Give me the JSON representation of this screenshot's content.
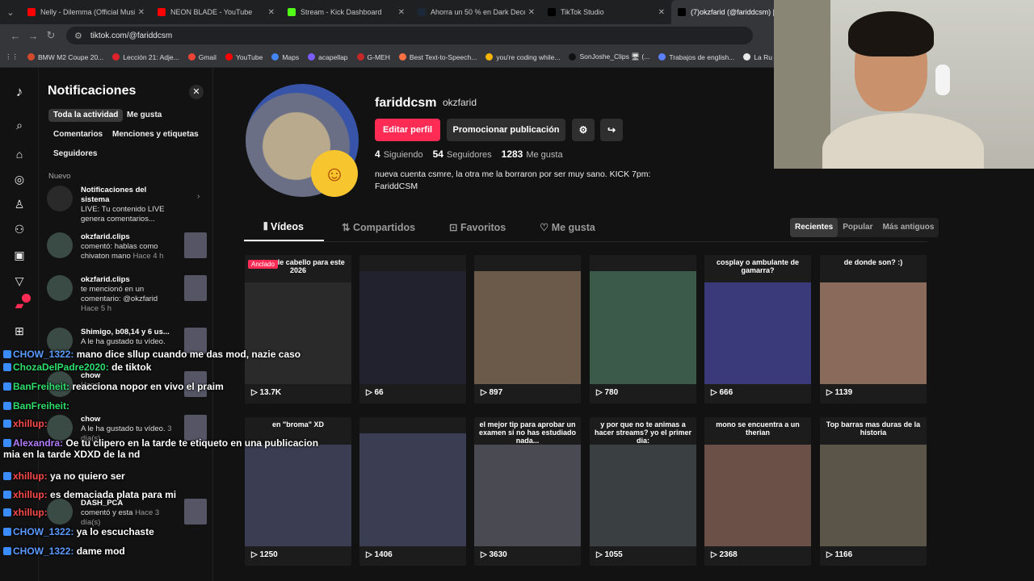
{
  "tabs": [
    {
      "title": "Nelly - Dilemma (Official Music",
      "color": "#ff0000",
      "active": false
    },
    {
      "title": "NEON BLADE - YouTube",
      "color": "#ff0000",
      "active": false
    },
    {
      "title": "Stream - Kick Dashboard",
      "color": "#53fc18",
      "active": false
    },
    {
      "title": "Ahorra un 50 % en Dark Decep",
      "color": "#1b2838",
      "active": false
    },
    {
      "title": "TikTok Studio",
      "color": "#000000",
      "active": false
    },
    {
      "title": "(7)okzfarid (@fariddcsm) | TikT",
      "color": "#000000",
      "active": true
    }
  ],
  "address": {
    "url": "tiktok.com/@fariddcsm"
  },
  "bookmarks": [
    "BMW M2 Coupe 20...",
    "Lección 21: Adje...",
    "Gmail",
    "YouTube",
    "Maps",
    "acapellap",
    "G-MEH",
    "Best Text-to-Speech...",
    "you're coding while...",
    "SonJoshe_Clips 🖥 (...",
    "Trabajos de english...",
    "La Ru"
  ],
  "rail": {
    "icons": [
      "tiktok-logo-icon",
      "search-icon",
      "home-icon",
      "explore-icon",
      "following-icon",
      "friends-icon",
      "live-icon",
      "messages-icon",
      "activity-icon",
      "upload-icon"
    ],
    "activity_badge": "7"
  },
  "notifications": {
    "title": "Notificaciones",
    "filters": [
      "Toda la actividad",
      "Me gusta",
      "Comentarios",
      "Menciones y etiquetas",
      "Seguidores"
    ],
    "section": "Nuevo",
    "items": [
      {
        "user": "Notificaciones del sistema",
        "text": "LIVE: Tu contenido LIVE genera comentarios...",
        "time": ""
      },
      {
        "user": "okzfarid.clips",
        "text": "comentó: hablas como chivaton mano",
        "time": "Hace 4 h"
      },
      {
        "user": "okzfarid.clips",
        "text": "te mencionó en un comentario: @okzfarid",
        "time": "Hace 5 h"
      },
      {
        "user": "Shimigo, b08,14 y 6 us...",
        "text": "A le ha gustado tu vídeo.",
        "time": ""
      },
      {
        "user": "chow",
        "text": "",
        "time": "Hace"
      },
      {
        "user": "chow",
        "text": "A le ha gustado tu vídeo.",
        "time": "3 día(s)"
      },
      {
        "user": "DASH_PCA",
        "text": "comentó y esta",
        "time": "Hace 3 día(s)"
      }
    ]
  },
  "profile": {
    "username": "fariddcsm",
    "nickname": "okzfarid",
    "edit_button": "Editar perfil",
    "promote_button": "Promocionar publicación",
    "following": "4",
    "following_label": "Siguiendo",
    "followers": "54",
    "followers_label": "Seguidores",
    "likes": "1283",
    "likes_label": "Me gusta",
    "bio": "nueva cuenta csmre, la otra me la borraron por ser muy sano. KICK 7pm: FariddCSM",
    "tabs": [
      "Vídeos",
      "Compartidos",
      "Favoritos",
      "Me gusta"
    ],
    "sort": [
      "Recientes",
      "Popular",
      "Más antiguos"
    ]
  },
  "videos": [
    {
      "caption": "cortes de cabello para este 2026",
      "views": "13.7K",
      "pinned": "Anclado",
      "bg": "#2a2a2a"
    },
    {
      "caption": "",
      "views": "66",
      "pinned": "",
      "bg": "#22222e"
    },
    {
      "caption": "",
      "views": "897",
      "pinned": "",
      "bg": "#6b5a4a"
    },
    {
      "caption": "",
      "views": "780",
      "pinned": "",
      "bg": "#3b5a4a"
    },
    {
      "caption": "cosplay o ambulante de gamarra?",
      "views": "666",
      "pinned": "",
      "bg": "#3a3a7a"
    },
    {
      "caption": "de donde son? :)",
      "views": "1139",
      "pinned": "",
      "bg": "#8a6a5a"
    },
    {
      "caption": "en \"broma\" XD",
      "views": "1250",
      "pinned": "",
      "bg": "#3b3d52"
    },
    {
      "caption": "",
      "views": "1406",
      "pinned": "",
      "bg": "#3b3d52"
    },
    {
      "caption": "el mejor tip para aprobar un examen si no has estudiado nada...",
      "views": "3630",
      "pinned": "",
      "bg": "#4a4a52"
    },
    {
      "caption": "y por que no te animas a hacer streams? yo el primer dia:",
      "views": "1055",
      "pinned": "",
      "bg": "#3a4042"
    },
    {
      "caption": "mono se encuentra a un therian",
      "views": "2368",
      "pinned": "",
      "bg": "#6b5048"
    },
    {
      "caption": "Top barras mas duras de la historia",
      "views": "1166",
      "pinned": "",
      "bg": "#5a5548"
    }
  ],
  "chat": [
    {
      "user": "CHOW_1322",
      "msg": "mano dice sllup cuando me das mod, nazie caso",
      "color": "#5b9bff"
    },
    {
      "user": "ChozaDelPadre2020",
      "msg": "de tiktok",
      "color": "#2ee06b"
    },
    {
      "user": "BanFreiheit",
      "msg": "reacciona nopor en vivo el praim",
      "color": "#2ee06b"
    },
    {
      "user": "BanFreiheit",
      "msg": "",
      "color": "#2ee06b"
    },
    {
      "user": "xhillup",
      "msg": "",
      "color": "#ff4b4b"
    },
    {
      "user": "Alexandra",
      "msg": "Oe tu clipero en la tarde te etiqueto en una publicacion mia en la tarde XDXD de la nd",
      "color": "#b47cff"
    },
    {
      "user": "xhillup",
      "msg": "ya no quiero ser",
      "color": "#ff4b4b"
    },
    {
      "user": "xhillup",
      "msg": "es demaciada plata para mi",
      "color": "#ff4b4b"
    },
    {
      "user": "xhillup",
      "msg": "",
      "color": "#ff4b4b"
    },
    {
      "user": "CHOW_1322",
      "msg": "ya lo escuchaste",
      "color": "#5b9bff"
    },
    {
      "user": "CHOW_1322",
      "msg": "dame mod",
      "color": "#5b9bff"
    }
  ]
}
